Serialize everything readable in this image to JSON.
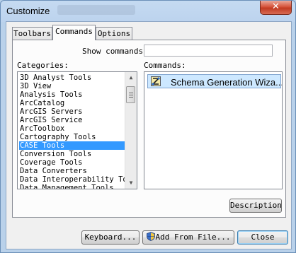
{
  "window": {
    "title": "Customize",
    "close_glyph": "✕"
  },
  "tabs": [
    {
      "label": "Toolbars",
      "active": false
    },
    {
      "label": "Commands",
      "active": true
    },
    {
      "label": "Options",
      "active": false
    }
  ],
  "show_commands": {
    "label": "Show commands",
    "value": ""
  },
  "categories": {
    "label": "Categories:",
    "selected": "CASE Tools",
    "items": [
      "3D Analyst Tools",
      "3D View",
      "Analysis Tools",
      "ArcCatalog",
      "ArcGIS Servers",
      "ArcGIS Service",
      "ArcToolbox",
      "Cartography Tools",
      "CASE Tools",
      "Conversion Tools",
      "Coverage Tools",
      "Data Converters",
      "Data Interoperability Too",
      "Data Management Tools"
    ]
  },
  "commands": {
    "label": "Commands:",
    "items": [
      {
        "label": "Schema Generation Wiza...",
        "icon": "schema-wizard-icon"
      }
    ]
  },
  "buttons": {
    "description": "Description",
    "keyboard": "Keyboard...",
    "add_from_file": "Add From File...",
    "close": "Close"
  },
  "colors": {
    "selection": "#3399ff",
    "command_highlight": "#cde8ff",
    "close_button": "#c13b22"
  }
}
